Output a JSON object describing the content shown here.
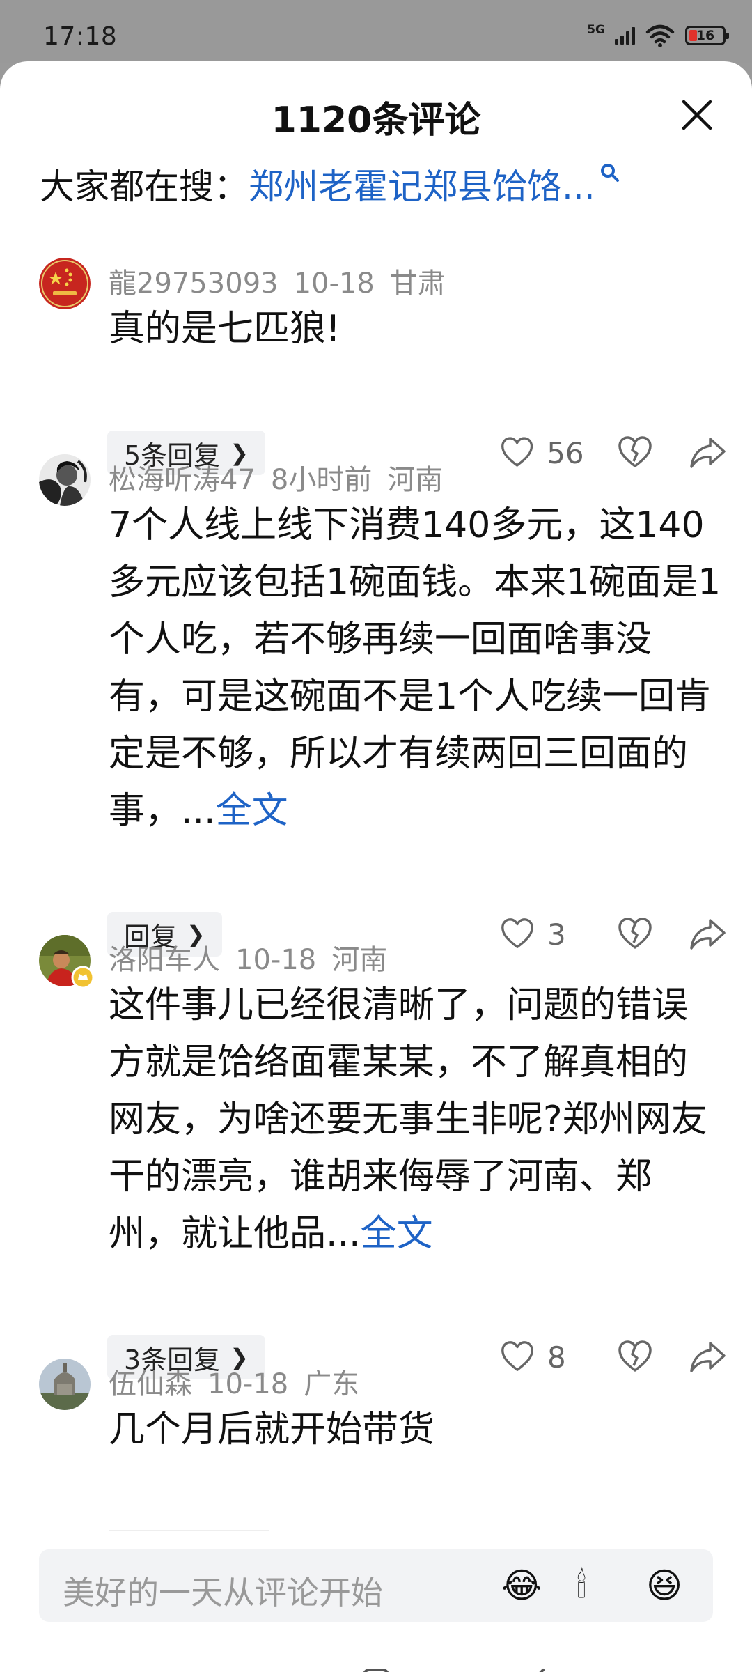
{
  "status_bar": {
    "time": "17:18",
    "network": "5G",
    "battery": "16"
  },
  "header": {
    "title": "1120条评论"
  },
  "search": {
    "label": "大家都在搜：",
    "query": "郑州老霍记郑县饸饹..."
  },
  "comments": [
    {
      "user": "龍29753093",
      "time": "10-18",
      "location": "甘肃",
      "text": "真的是七匹狼!",
      "more": "",
      "reply_label": "5条回复",
      "likes": "56"
    },
    {
      "user": "松海听涛47",
      "time": "8小时前",
      "location": "河南",
      "text": "7个人线上线下消费140多元，这140多元应该包括1碗面钱。本来1碗面是1个人吃，若不够再续一回面啥事没有，可是这碗面不是1个人吃续一回肯定是不够，所以才有续两回三回面的事，...",
      "more": "全文",
      "reply_label": "回复",
      "likes": "3"
    },
    {
      "user": "洛阳车人",
      "time": "10-18",
      "location": "河南",
      "text": "这件事儿已经很清晰了，问题的错误方就是饸络面霍某某，不了解真相的网友，为啥还要无事生非呢?郑州网友干的漂亮，谁胡来侮辱了河南、郑州，就让他品...",
      "more": "全文",
      "reply_label": "3条回复",
      "likes": "8"
    },
    {
      "user": "伍仙森",
      "time": "10-18",
      "location": "广东",
      "text": "几个月后就开始带货",
      "more": ""
    }
  ],
  "input": {
    "placeholder": "美好的一天从评论开始",
    "emojis": [
      "😂",
      "🕯",
      "😆"
    ]
  },
  "icons": {
    "close": "close-icon",
    "search": "search-icon",
    "like": "heart-icon",
    "dislike": "broken-heart-icon",
    "share": "share-icon",
    "menu": "menu-icon",
    "home": "home-icon",
    "back": "back-icon"
  },
  "colors": {
    "link": "#1e63c6",
    "muted": "#8a8a8a",
    "battery_low": "#e0312b"
  }
}
